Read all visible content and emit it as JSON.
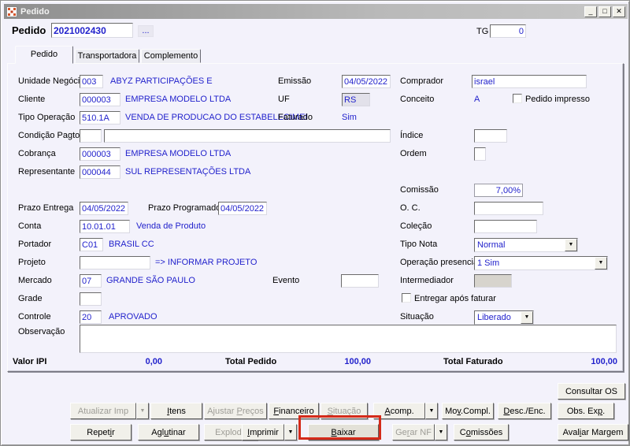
{
  "window": {
    "title": "Pedido"
  },
  "header": {
    "pedido_label": "Pedido",
    "pedido_value": "2021002430",
    "lookup_label": "...",
    "tg_label": "TG",
    "tg_value": "0"
  },
  "tabs": {
    "pedido": "Pedido",
    "transportadora": "Transportadora",
    "complemento": "Complemento"
  },
  "form": {
    "unidade_negocio": {
      "label": "Unidade Negócio",
      "code": "003",
      "desc": "ABYZ PARTICIPAÇÕES E"
    },
    "emissao": {
      "label": "Emissão",
      "value": "04/05/2022"
    },
    "comprador": {
      "label": "Comprador",
      "value": "israel"
    },
    "cliente": {
      "label": "Cliente",
      "code": "000003",
      "desc": "EMPRESA MODELO LTDA"
    },
    "uf": {
      "label": "UF",
      "value": "RS"
    },
    "conceito": {
      "label": "Conceito",
      "value": "A"
    },
    "pedido_impresso": {
      "label": "Pedido impresso",
      "checked": false
    },
    "tipo_operacao": {
      "label": "Tipo Operação",
      "code": "510.1A",
      "desc": "VENDA DE PRODUCAO DO ESTABELECIMEI"
    },
    "faturado": {
      "label": "Faturado",
      "value": "Sim"
    },
    "condicao_pagto": {
      "label": "Condição Pagto.",
      "code": "",
      "desc": ""
    },
    "indice": {
      "label": "Índice",
      "value": ""
    },
    "cobranca": {
      "label": "Cobrança",
      "code": "000003",
      "desc": "EMPRESA MODELO LTDA"
    },
    "ordem": {
      "label": "Ordem",
      "value": ""
    },
    "representante": {
      "label": "Representante",
      "code": "000044",
      "desc": "SUL REPRESENTAÇÕES LTDA"
    },
    "comissao": {
      "label": "Comissão",
      "value": "7,00%"
    },
    "prazo_entrega": {
      "label": "Prazo Entrega",
      "value": "04/05/2022"
    },
    "prazo_programado": {
      "label": "Prazo Programado",
      "value": "04/05/2022"
    },
    "oc": {
      "label": "O. C.",
      "value": ""
    },
    "conta": {
      "label": "Conta",
      "code": "10.01.01",
      "desc": "Venda de Produto"
    },
    "colecao": {
      "label": "Coleção",
      "value": ""
    },
    "portador": {
      "label": "Portador",
      "code": "C01",
      "desc": "BRASIL CC"
    },
    "tipo_nota": {
      "label": "Tipo Nota",
      "value": "Normal"
    },
    "projeto": {
      "label": "Projeto",
      "value": "",
      "hint": "=> INFORMAR PROJETO"
    },
    "operacao_presencial": {
      "label": "Operação presencial",
      "value": "1 Sim"
    },
    "mercado": {
      "label": "Mercado",
      "code": "07",
      "desc": "GRANDE SÃO PAULO"
    },
    "evento": {
      "label": "Evento",
      "value": ""
    },
    "intermediador": {
      "label": "Intermediador",
      "value": ""
    },
    "grade": {
      "label": "Grade",
      "value": ""
    },
    "entregar_apos_faturar": {
      "label": "Entregar após faturar",
      "checked": false
    },
    "controle": {
      "label": "Controle",
      "code": "20",
      "desc": "APROVADO"
    },
    "situacao_campo": {
      "label": "Situação",
      "value": "Liberado"
    },
    "observacao": {
      "label": "Observação",
      "value": ""
    }
  },
  "totals": {
    "valor_ipi_label": "Valor IPI",
    "valor_ipi": "0,00",
    "total_pedido_label": "Total Pedido",
    "total_pedido": "100,00",
    "total_faturado_label": "Total Faturado",
    "total_faturado": "100,00"
  },
  "actions": {
    "consultar_os": "Consultar OS",
    "atualizar_imp": "Atualizar Imp",
    "itens": "Itens",
    "ajustar_precos": "Ajustar Preços",
    "financeiro": "Financeiro",
    "situacao": "Situação",
    "acomp": "Acomp.",
    "mov_compl": "Mov.Compl.",
    "desc_enc": "Desc./Enc.",
    "obs_exp": "Obs. Exp.",
    "repetir": "Repetir",
    "aglutinar": "Aglutinar",
    "explodir": "Explodir",
    "imprimir": "Imprimir",
    "baixar": "Baixar",
    "gerar_nf": "Gerar NF",
    "comissoes": "Comissões",
    "avaliar_margem": "Avaliar Margem"
  },
  "colors": {
    "value_blue": "#2222cc",
    "highlight_red": "#d42a1a",
    "icon_orange": "#d4552a"
  }
}
